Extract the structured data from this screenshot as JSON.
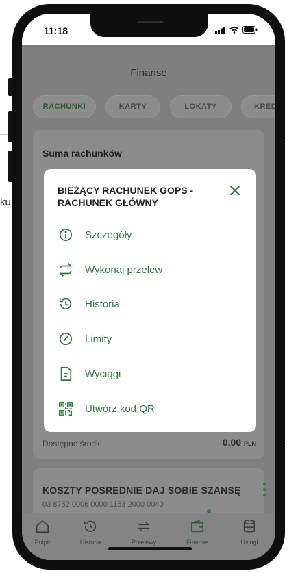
{
  "left_fragment_text": "ku",
  "status_bar": {
    "time": "11:18"
  },
  "header": {
    "title": "Finanse"
  },
  "tabs": [
    {
      "label": "RACHUNKI",
      "active": true
    },
    {
      "label": "KARTY",
      "active": false
    },
    {
      "label": "LOKATY",
      "active": false
    },
    {
      "label": "KRED",
      "active": false
    }
  ],
  "summary": {
    "title": "Suma rachunków"
  },
  "available": {
    "label": "Dostępne środki",
    "amount": "0,00",
    "currency": "PLN"
  },
  "account": {
    "name": "KOSZTY POSREDNIE DAJ SOBIE SZANSĘ",
    "number": "03 8752 0006 0000 1153 2000 0040"
  },
  "modal": {
    "title": "BIEŻĄCY RACHUNEK GOPS - RACHUNEK GŁÓWNY",
    "items": [
      {
        "label": "Szczegóły",
        "icon": "info-icon"
      },
      {
        "label": "Wykonaj przelew",
        "icon": "transfer-icon"
      },
      {
        "label": "Historia",
        "icon": "history-icon"
      },
      {
        "label": "Limity",
        "icon": "gauge-icon"
      },
      {
        "label": "Wyciągi",
        "icon": "document-icon"
      },
      {
        "label": "Utwórz kod QR",
        "icon": "qr-code-icon"
      }
    ]
  },
  "bottom_nav": [
    {
      "label": "Pulpit",
      "icon": "home-icon",
      "active": false
    },
    {
      "label": "Historia",
      "icon": "history-icon",
      "active": false
    },
    {
      "label": "Przelewy",
      "icon": "transfer-icon",
      "active": false
    },
    {
      "label": "Finanse",
      "icon": "wallet-icon",
      "active": true
    },
    {
      "label": "Usługi",
      "icon": "database-icon",
      "active": false
    }
  ],
  "colors": {
    "accent": "#2f7a3f",
    "overlay": "#808080",
    "modal_bg": "#ffffff"
  }
}
